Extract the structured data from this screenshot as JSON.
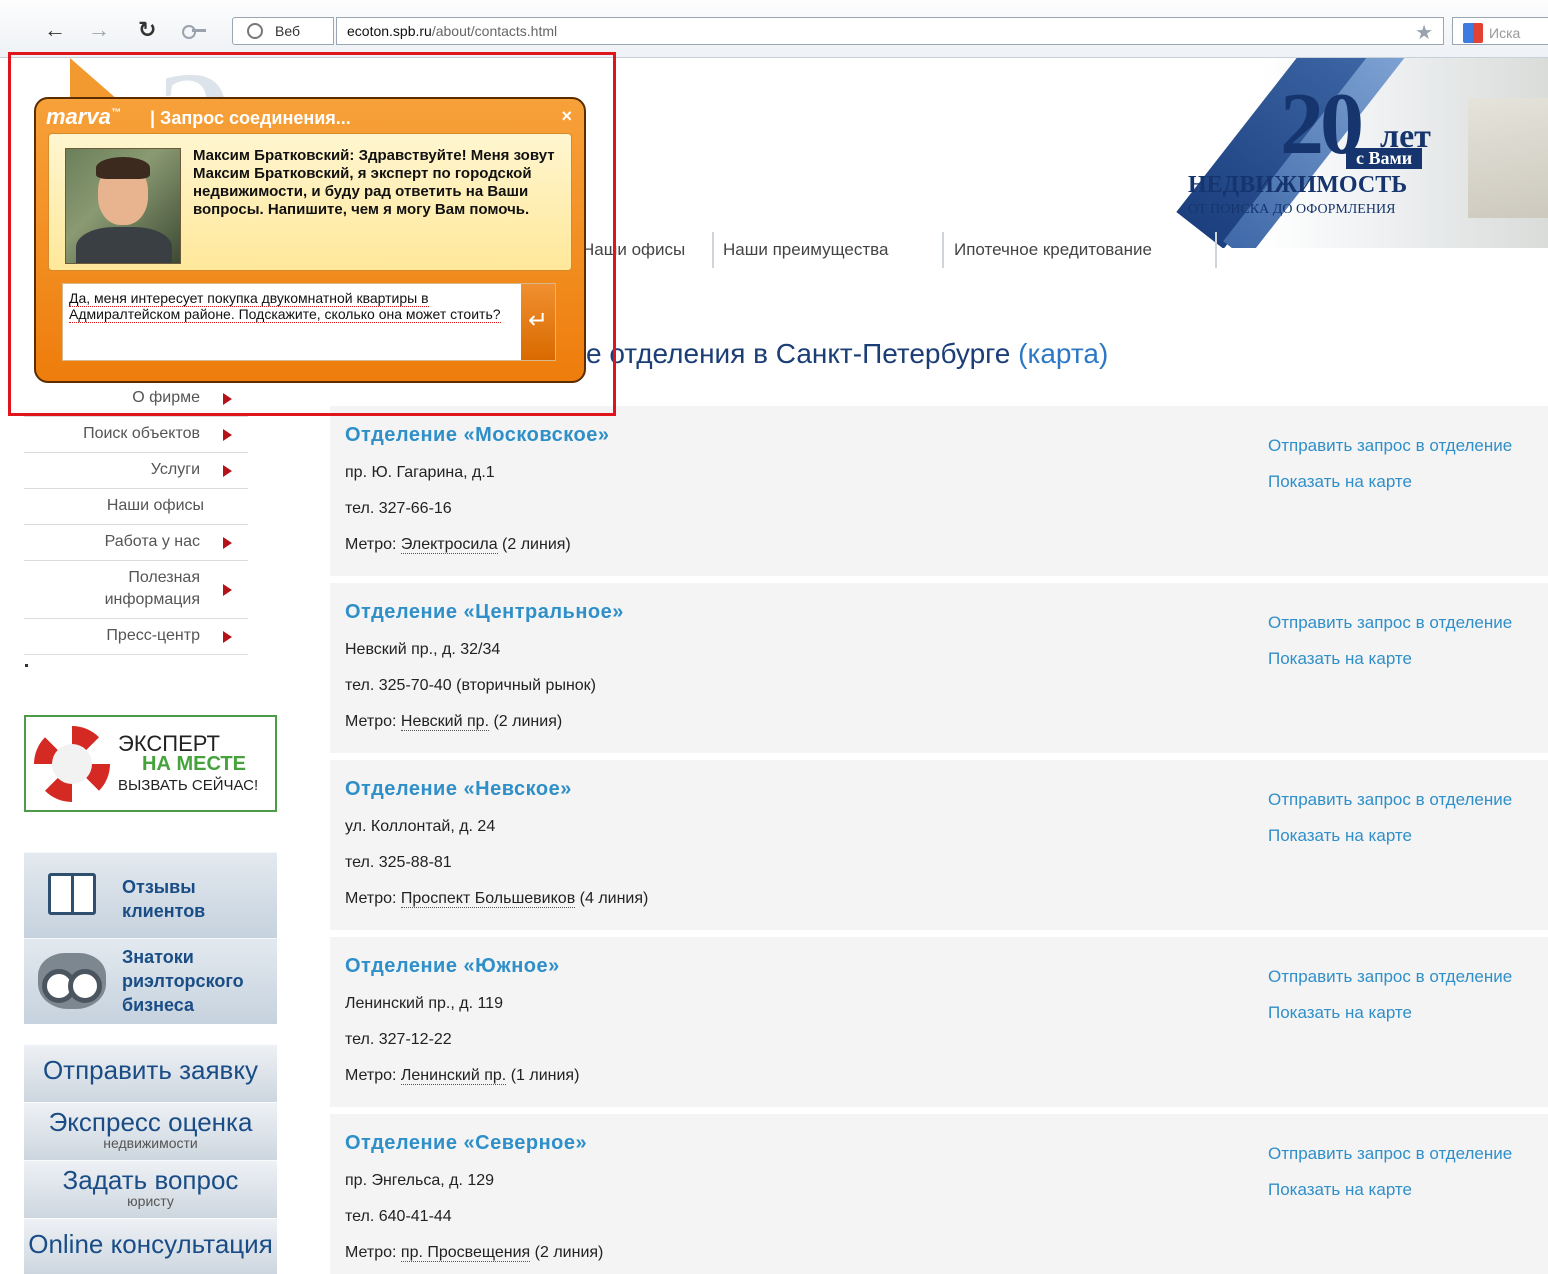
{
  "browser": {
    "search_type": "Веб",
    "url_host": "ecoton.spb.ru",
    "url_path": "/about/contacts.html",
    "search_placeholder": "Иска"
  },
  "header": {
    "anniversary_number": "20",
    "anniversary_let": "лет",
    "anniversary_svami": "с Вами",
    "title": "НЕДВИЖИМОСТЬ",
    "subtitle": "ОТ ПОИСКА ДО ОФОРМЛЕНИЯ"
  },
  "topnav": {
    "items": [
      {
        "label": "Наши офисы"
      },
      {
        "label": "Наши преимущества"
      },
      {
        "label": "Ипотечное кредитование"
      }
    ]
  },
  "sidebar": {
    "items": [
      {
        "label": "О фирме",
        "has_arrow": true
      },
      {
        "label": "Поиск объектов",
        "has_arrow": true
      },
      {
        "label": "Услуги",
        "has_arrow": true
      },
      {
        "label": "Наши офисы",
        "has_arrow": false
      },
      {
        "label": "Работа у нас",
        "has_arrow": true
      },
      {
        "label": "Полезная информация",
        "has_arrow": true
      },
      {
        "label": "Пресс-центр",
        "has_arrow": true
      }
    ],
    "expert": {
      "line1": "ЭКСПЕРТ",
      "line2": "НА МЕСТЕ",
      "line3": "ВЫЗВАТЬ СЕЙЧАС!"
    },
    "reviews": "Отзывы клиентов",
    "experts_club": "Знатоки риэлторского бизнеса",
    "send_request": "Отправить заявку",
    "express": {
      "title": "Экспресс оценка",
      "sub": "недвижимости"
    },
    "ask": {
      "title": "Задать вопрос",
      "sub": "юристу"
    },
    "online": "Online консультация"
  },
  "main": {
    "heading": "е отделения в Санкт-Петербурге",
    "heading_link": "(карта)",
    "offices": [
      {
        "name": "Отделение «Московское»",
        "address": "пр. Ю. Гагарина, д.1",
        "phone": "тел. 327-66-16",
        "metro_label": "Метро:",
        "metro": "Электросила",
        "line": "(2 линия)"
      },
      {
        "name": "Отделение «Центральное»",
        "address": "Невский пр., д. 32/34",
        "phone": "тел. 325-70-40 (вторичный рынок)",
        "metro_label": "Метро:",
        "metro": "Невский пр.",
        "line": "(2 линия)"
      },
      {
        "name": "Отделение «Невское»",
        "address": "ул. Коллонтай, д. 24",
        "phone": "тел. 325-88-81",
        "metro_label": "Метро:",
        "metro": "Проспект Большевиков",
        "line": "(4 линия)"
      },
      {
        "name": "Отделение «Южное»",
        "address": "Ленинский пр., д. 119",
        "phone": "тел. 327-12-22",
        "metro_label": "Метро:",
        "metro": "Ленинский пр.",
        "line": "(1 линия)"
      },
      {
        "name": "Отделение «Северное»",
        "address": "пр. Энгельса, д. 129",
        "phone": "тел. 640-41-44",
        "metro_label": "Метро:",
        "metro": "пр. Просвещения",
        "line": "(2 линия)"
      }
    ],
    "send_request_link": "Отправить запрос в отделение",
    "show_map_link": "Показать на карте"
  },
  "chat": {
    "brand": "marva",
    "title": "| Запрос соединения...",
    "close": "×",
    "message": "Максим Братковский: Здравствуйте! Меня зовут Максим Братковский, я эксперт по городской недвижимости, и буду рад ответить на Ваши вопросы. Напишите, чем я могу Вам помочь.",
    "input_value": "Да, меня интересует покупка двукомнатной квартиры в Адмиралтейском районе. Подскажите, сколько она может стоить?",
    "send_icon": "↵"
  },
  "colors": {
    "accent": "#2f8fc9",
    "heading": "#1a3e75",
    "chat_orange": "#ee7d0c",
    "highlight": "#e0141b"
  }
}
